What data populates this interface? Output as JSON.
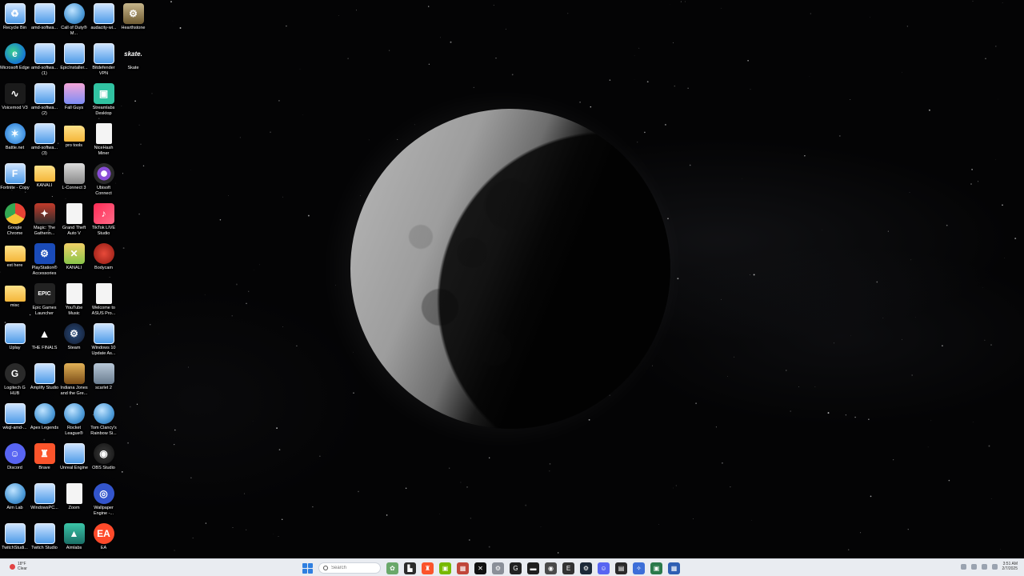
{
  "desktop": {
    "icons": [
      {
        "label": "Recycle Bin",
        "icon": "recycle-bin-icon",
        "glyph": "♻",
        "style": "g-win"
      },
      {
        "label": "amd-softwa...",
        "icon": "file-icon",
        "glyph": "",
        "style": "g-win"
      },
      {
        "label": "Call of Duty® M...",
        "icon": "globe-icon",
        "glyph": "",
        "style": "g-globe"
      },
      {
        "label": "audacity-wi...",
        "icon": "file-icon",
        "glyph": "",
        "style": "g-win"
      },
      {
        "label": "Hearthstone",
        "icon": "hearthstone-icon",
        "glyph": "⚙",
        "style": "g-hearth"
      },
      {
        "label": "Microsoft Edge",
        "icon": "edge-icon",
        "glyph": "e",
        "style": "g-edge"
      },
      {
        "label": "amd-softwa... (1)",
        "icon": "file-icon",
        "glyph": "",
        "style": "g-win"
      },
      {
        "label": "EpicInstaller...",
        "icon": "installer-icon",
        "glyph": "",
        "style": "g-win"
      },
      {
        "label": "Bitdefender VPN",
        "icon": "file-icon",
        "glyph": "",
        "style": "g-win"
      },
      {
        "label": "Skate",
        "icon": "skate-icon",
        "glyph": "skate.",
        "style": "g-skate"
      },
      {
        "label": "Voicemod V3",
        "icon": "voicemod-icon",
        "glyph": "∿",
        "style": "g-dark"
      },
      {
        "label": "amd-softwa... (2)",
        "icon": "file-icon",
        "glyph": "",
        "style": "g-win"
      },
      {
        "label": "Fall Guys",
        "icon": "fall-guys-icon",
        "glyph": "",
        "style": "g-fall"
      },
      {
        "label": "Streamlabs Desktop",
        "icon": "streamlabs-icon",
        "glyph": "▣",
        "style": "g-streamlabs"
      },
      null,
      {
        "label": "Battle.net",
        "icon": "battlenet-icon",
        "glyph": "✶",
        "style": "g-bnet"
      },
      {
        "label": "amd-softwa... (3)",
        "icon": "file-icon",
        "glyph": "",
        "style": "g-win"
      },
      {
        "label": "pro tools",
        "icon": "folder-icon",
        "glyph": "",
        "style": "g-folder"
      },
      {
        "label": "NiceHash Miner",
        "icon": "file-icon",
        "glyph": "",
        "style": "g-nice"
      },
      null,
      {
        "label": "Fortnite - Copy",
        "icon": "fortnite-icon",
        "glyph": "F",
        "style": "g-win"
      },
      {
        "label": "KANALI",
        "icon": "folder-icon",
        "glyph": "",
        "style": "g-folder"
      },
      {
        "label": "L-Connect 3",
        "icon": "lconnect-icon",
        "glyph": "",
        "style": "g-lconnect"
      },
      {
        "label": "Ubisoft Connect",
        "icon": "ubisoft-icon",
        "glyph": "",
        "style": "g-ubisoft"
      },
      null,
      {
        "label": "Google Chrome",
        "icon": "chrome-icon",
        "glyph": "",
        "style": "g-chrome"
      },
      {
        "label": "Magic: The Gatherin...",
        "icon": "magic-icon",
        "glyph": "✦",
        "style": "g-magic"
      },
      {
        "label": "Grand Theft Auto V",
        "icon": "file-icon",
        "glyph": "",
        "style": "g-nice"
      },
      {
        "label": "TikTok LIVE Studio",
        "icon": "tiktok-icon",
        "glyph": "♪",
        "style": "g-tiktok"
      },
      null,
      {
        "label": "ext here",
        "icon": "folder-icon",
        "glyph": "",
        "style": "g-folder"
      },
      {
        "label": "PlayStation® Accessories",
        "icon": "playstation-icon",
        "glyph": "⚙",
        "style": "g-ps"
      },
      {
        "label": "KANALI",
        "icon": "kanali-icon",
        "glyph": "✕",
        "style": "g-kanali"
      },
      {
        "label": "Bodycam",
        "icon": "bodycam-icon",
        "glyph": "",
        "style": "g-red"
      },
      null,
      {
        "label": "misc",
        "icon": "folder-icon",
        "glyph": "",
        "style": "g-folder"
      },
      {
        "label": "Epic Games Launcher",
        "icon": "epic-icon",
        "glyph": "EPIC",
        "style": "g-epic"
      },
      {
        "label": "YouTube Music",
        "icon": "file-icon",
        "glyph": "",
        "style": "g-nice"
      },
      {
        "label": "Welcome to ASUS Pro...",
        "icon": "file-icon",
        "glyph": "",
        "style": "g-nice"
      },
      null,
      {
        "label": "Uplay",
        "icon": "file-icon",
        "glyph": "",
        "style": "g-win"
      },
      {
        "label": "THE FINALS",
        "icon": "finals-icon",
        "glyph": "▲",
        "style": "g-finals"
      },
      {
        "label": "Steam",
        "icon": "steam-icon",
        "glyph": "⚙",
        "style": "g-steam"
      },
      {
        "label": "Windows 10 Update As...",
        "icon": "file-icon",
        "glyph": "",
        "style": "g-win"
      },
      null,
      {
        "label": "Logitech G HUB",
        "icon": "logitech-icon",
        "glyph": "G",
        "style": "g-logi"
      },
      {
        "label": "Amplify Studio",
        "icon": "file-icon",
        "glyph": "",
        "style": "g-win"
      },
      {
        "label": "Indiana Jones and the Gre...",
        "icon": "indiana-icon",
        "glyph": "",
        "style": "g-indiana"
      },
      {
        "label": "scarlet 2",
        "icon": "scarlett-icon",
        "glyph": "",
        "style": "g-scarlett"
      },
      null,
      {
        "label": "wkql-amd-...",
        "icon": "file-icon",
        "glyph": "",
        "style": "g-win"
      },
      {
        "label": "Apex Legends",
        "icon": "globe-icon",
        "glyph": "",
        "style": "g-globe"
      },
      {
        "label": "Rocket League®",
        "icon": "globe-icon",
        "glyph": "",
        "style": "g-globe"
      },
      {
        "label": "Tom Clancy's Rainbow Si...",
        "icon": "globe-icon",
        "glyph": "",
        "style": "g-globe"
      },
      null,
      {
        "label": "Discord",
        "icon": "discord-icon",
        "glyph": "☺",
        "style": "g-discord"
      },
      {
        "label": "Brave",
        "icon": "brave-icon",
        "glyph": "♜",
        "style": "g-brave"
      },
      {
        "label": "Unreal Engine",
        "icon": "file-icon",
        "glyph": "",
        "style": "g-win"
      },
      {
        "label": "OBS Studio",
        "icon": "obs-icon",
        "glyph": "◉",
        "style": "g-obs"
      },
      null,
      {
        "label": "Aim Lab",
        "icon": "globe-icon",
        "glyph": "",
        "style": "g-globe"
      },
      {
        "label": "WindowsPC...",
        "icon": "file-icon",
        "glyph": "",
        "style": "g-win"
      },
      {
        "label": "Zoom",
        "icon": "file-icon",
        "glyph": "",
        "style": "g-nice"
      },
      {
        "label": "Wallpaper Engine -...",
        "icon": "wallpaper-engine-icon",
        "glyph": "◎",
        "style": "g-wallpaper"
      },
      null,
      {
        "label": "TwitchStudi...",
        "icon": "file-icon",
        "glyph": "",
        "style": "g-win"
      },
      {
        "label": "Twitch Studio",
        "icon": "file-icon",
        "glyph": "",
        "style": "g-win"
      },
      {
        "label": "Aimlabs",
        "icon": "aimlabs-icon",
        "glyph": "▲",
        "style": "g-aim"
      },
      {
        "label": "EA",
        "icon": "ea-icon",
        "glyph": "EA",
        "style": "g-ea"
      },
      null
    ]
  },
  "taskbar": {
    "weather": {
      "temp": "18°F",
      "condition": "Clear"
    },
    "search": {
      "placeholder": "Search"
    },
    "apps": [
      {
        "icon": "widgets-icon",
        "color": "#6aa86a",
        "glyph": "✿"
      },
      {
        "icon": "file-explorer-icon",
        "color": "#2b2b2b",
        "glyph": "▙"
      },
      {
        "icon": "brave-taskbar-icon",
        "color": "#fb542b",
        "glyph": "♜"
      },
      {
        "icon": "nvidia-icon",
        "color": "#76b900",
        "glyph": "▣"
      },
      {
        "icon": "taskbar-app-icon",
        "color": "#c0463a",
        "glyph": "▦"
      },
      {
        "icon": "capcut-icon",
        "color": "#111111",
        "glyph": "✕"
      },
      {
        "icon": "settings-icon",
        "color": "#8a8f98",
        "glyph": "⚙"
      },
      {
        "icon": "logitech-taskbar-icon",
        "color": "#222222",
        "glyph": "G"
      },
      {
        "icon": "taskbar-app-icon",
        "color": "#1f1f1f",
        "glyph": "▬"
      },
      {
        "icon": "obs-taskbar-icon",
        "color": "#4a4a4a",
        "glyph": "◉"
      },
      {
        "icon": "epic-taskbar-icon",
        "color": "#333333",
        "glyph": "E"
      },
      {
        "icon": "steam-taskbar-icon",
        "color": "#1b2838",
        "glyph": "⚙"
      },
      {
        "icon": "discord-taskbar-icon",
        "color": "#5865f2",
        "glyph": "☺"
      },
      {
        "icon": "taskbar-app-icon",
        "color": "#2a2a2a",
        "glyph": "▤"
      },
      {
        "icon": "taskbar-app-icon",
        "color": "#3c6ed8",
        "glyph": "✧"
      },
      {
        "icon": "taskbar-app-icon",
        "color": "#2b7a4b",
        "glyph": "▣"
      },
      {
        "icon": "taskbar-app-icon",
        "color": "#2f5fb3",
        "glyph": "▦"
      }
    ],
    "tray": {
      "time": "3:51 AM",
      "date": "2/7/2025"
    }
  }
}
